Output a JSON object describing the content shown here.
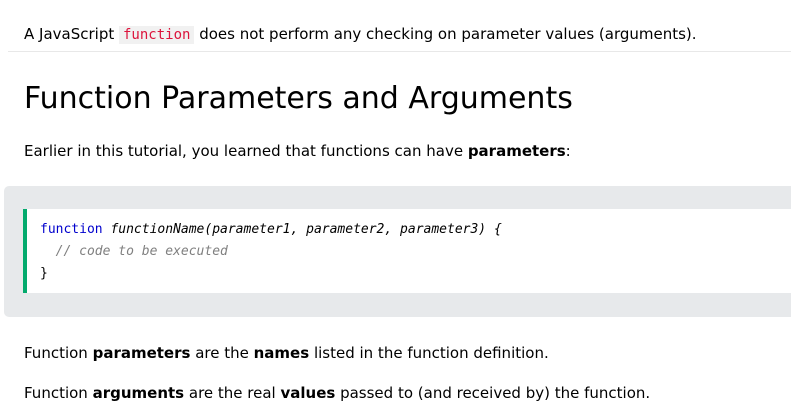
{
  "intro": {
    "before": "A JavaScript ",
    "code": "function",
    "after": " does not perform any checking on parameter values (arguments)."
  },
  "heading": "Function Parameters and Arguments",
  "para1": {
    "text": "Earlier in this tutorial, you learned that functions can have ",
    "bold": "parameters",
    "end": ":"
  },
  "code_example": {
    "keyword": "function",
    "signature": "functionName(parameter1, parameter2, parameter3) {",
    "comment": "// code to be executed",
    "close": "}",
    "accent_color": "#04aa6d",
    "panel_color": "#e7e9eb"
  },
  "para2": {
    "t1": "Function ",
    "b1": "parameters",
    "t2": " are the ",
    "b2": "names",
    "t3": " listed in the function definition."
  },
  "para3": {
    "t1": "Function ",
    "b1": "arguments",
    "t2": " are the real ",
    "b2": "values",
    "t3": " passed to (and received by) the function."
  }
}
